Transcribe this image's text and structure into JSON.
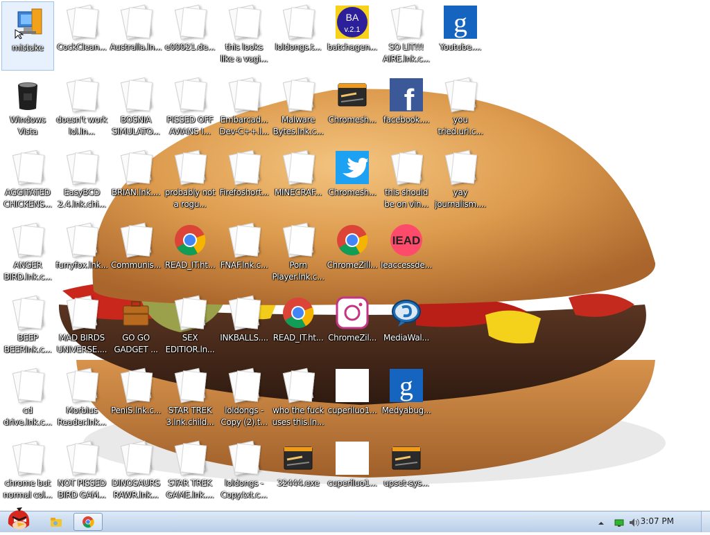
{
  "desktop": {
    "icons": [
      {
        "label": "mistake",
        "icon": "computer-icon"
      },
      {
        "label": "CockClean...",
        "icon": "document-icon"
      },
      {
        "label": "Australia.ln...",
        "icon": "document-icon"
      },
      {
        "label": "e00021.de...",
        "icon": "document-icon"
      },
      {
        "label": "this looks like a vagi...",
        "icon": "document-icon"
      },
      {
        "label": "loldongs.t...",
        "icon": "document-icon"
      },
      {
        "label": "batchagen...",
        "icon": "ba-icon"
      },
      {
        "label": "SO LIT!!! AIRE.lnk.c...",
        "icon": "document-icon"
      },
      {
        "label": "Youtube....",
        "icon": "google-icon"
      },
      {
        "label": "Windows Vista",
        "icon": "trash-icon"
      },
      {
        "label": "doesn't work lol.ln...",
        "icon": "document-icon"
      },
      {
        "label": "BOSNIA SIMULATO...",
        "icon": "document-icon"
      },
      {
        "label": "PISSED OFF AVIANS I...",
        "icon": "document-icon"
      },
      {
        "label": "Embarcad... Dev-C++.l...",
        "icon": "document-icon"
      },
      {
        "label": "Malware Bytes.lnk.c...",
        "icon": "document-icon"
      },
      {
        "label": "Chromesh...",
        "icon": "app-window-icon"
      },
      {
        "label": "facebook....",
        "icon": "facebook-icon"
      },
      {
        "label": "you tried.url.c...",
        "icon": "document-icon"
      },
      {
        "label": "AGGITATED CHICKENS...",
        "icon": "document-icon"
      },
      {
        "label": "EasyBCD 2.4.lnk.chi...",
        "icon": "document-icon"
      },
      {
        "label": "BRIAN.lnk....",
        "icon": "document-icon"
      },
      {
        "label": "probably not a rogu...",
        "icon": "document-icon"
      },
      {
        "label": "Firefoshort...",
        "icon": "document-icon"
      },
      {
        "label": "MINECRAF...",
        "icon": "document-icon"
      },
      {
        "label": "Chromesh...",
        "icon": "twitter-icon"
      },
      {
        "label": "this should be on vin...",
        "icon": "document-icon"
      },
      {
        "label": "yay journalism....",
        "icon": "document-icon"
      },
      {
        "label": "ANGER BIRD.lnk.c...",
        "icon": "document-icon"
      },
      {
        "label": "furryfox.lnk...",
        "icon": "document-icon"
      },
      {
        "label": "Communis...",
        "icon": "document-icon"
      },
      {
        "label": "READ_IT.ht...",
        "icon": "chrome-icon"
      },
      {
        "label": "FNAF.lnk.c...",
        "icon": "document-icon"
      },
      {
        "label": "Porn Player.lnk.c...",
        "icon": "document-icon"
      },
      {
        "label": "ChromeZill...",
        "icon": "chrome-icon"
      },
      {
        "label": "Ieaccessde...",
        "icon": "iead-icon",
        "badge": "IEAD"
      },
      {
        "label": "BEEP BEEP.lnk.c...",
        "icon": "document-icon"
      },
      {
        "label": "MAD BIRDS UNIVERSE....",
        "icon": "document-icon"
      },
      {
        "label": "GO GO GADGET ...",
        "icon": "briefcase-icon"
      },
      {
        "label": "SEX EDITIOR.ln...",
        "icon": "document-icon"
      },
      {
        "label": "INKBALLS....",
        "icon": "document-icon"
      },
      {
        "label": "READ_IT.ht...",
        "icon": "chrome-icon"
      },
      {
        "label": "ChromeZil...",
        "icon": "instagram-icon"
      },
      {
        "label": "MediaWal...",
        "icon": "media-icon"
      },
      {
        "label": "cd drive.lnk.c...",
        "icon": "document-icon"
      },
      {
        "label": "Morbius Reader.lnk...",
        "icon": "document-icon"
      },
      {
        "label": "PeniS.lnk.c...",
        "icon": "document-icon"
      },
      {
        "label": "STAR TREK 3.lnk.child...",
        "icon": "document-icon"
      },
      {
        "label": "loldongs - Copy (2).t...",
        "icon": "document-icon"
      },
      {
        "label": "who the fuck uses this.ln...",
        "icon": "document-icon"
      },
      {
        "label": "cuperiluo1...",
        "icon": "blank-icon"
      },
      {
        "label": "Medyabug...",
        "icon": "google-icon"
      },
      {
        "label": "chrome but normal col...",
        "icon": "document-icon"
      },
      {
        "label": "NOT PISSED BIRD GAM...",
        "icon": "document-icon"
      },
      {
        "label": "DINOSAURS RAWR.lnk...",
        "icon": "document-icon"
      },
      {
        "label": "STAR TREK GAME.lnk....",
        "icon": "document-icon"
      },
      {
        "label": "loldongs - Copy.txt.c...",
        "icon": "document-icon"
      },
      {
        "label": "32444.exe",
        "icon": "app-window-icon"
      },
      {
        "label": "cuperiluo1...",
        "icon": "blank-icon"
      },
      {
        "label": "upset-sys...",
        "icon": "app-window-icon"
      }
    ]
  },
  "badges": {
    "ba_top": "BA",
    "ba_bottom": "v.2.1",
    "google": "g",
    "facebook": "f"
  },
  "taskbar": {
    "start_icon": "angry-bird-icon",
    "pinned": [
      "explorer-folder-icon",
      "chrome-icon"
    ],
    "clock": "3:07 PM",
    "tray": [
      "tray-up-arrow-icon",
      "network-icon",
      "volume-icon"
    ]
  },
  "colors": {
    "taskbar": "#c8daf0",
    "google_blue": "#1565c0",
    "facebook_blue": "#3b5998",
    "twitter_blue": "#1da1f2"
  }
}
